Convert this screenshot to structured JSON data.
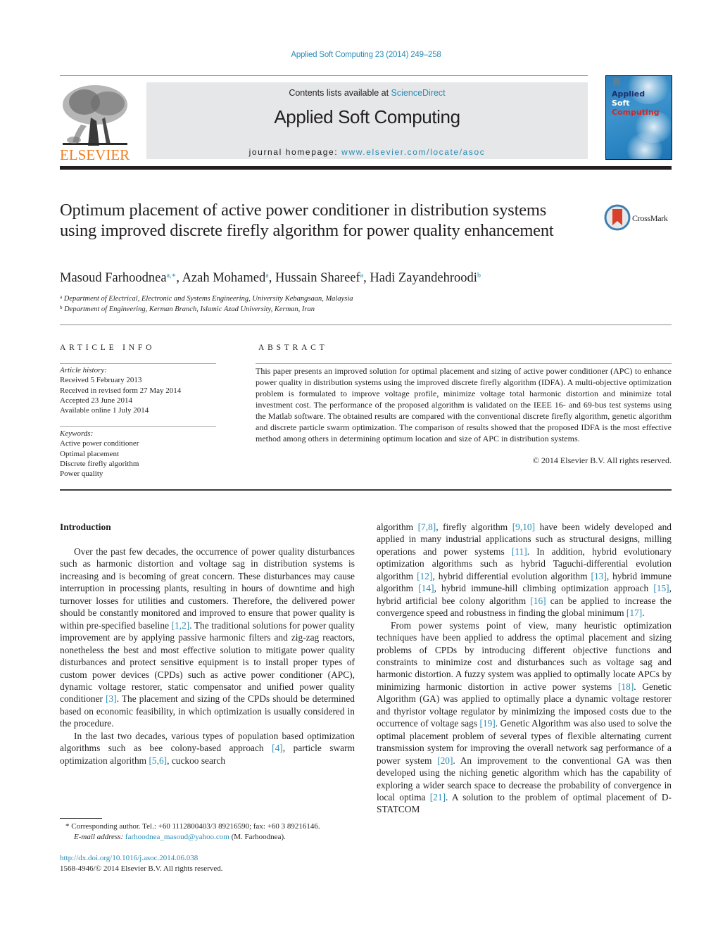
{
  "header": {
    "journal_ref": "Applied Soft Computing 23 (2014) 249–258",
    "contents_prefix": "Contents lists available at ",
    "contents_link": "ScienceDirect",
    "journal_title": "Applied Soft Computing",
    "homepage_prefix": "journal homepage: ",
    "homepage_link": "www.elsevier.com/locate/asoc",
    "publisher_logo_text": "ELSEVIER",
    "cover": {
      "line1": "Applied",
      "line2": "Soft",
      "line3": "Computing"
    },
    "colors": {
      "link": "#2a8cb5",
      "elsevier_orange": "#f07f24",
      "cover_blue": "#2b7fbd",
      "cover_red": "#d7261e",
      "masthead_gray": "#e6e7e8"
    }
  },
  "article": {
    "title": "Optimum placement of active power conditioner in distribution systems using improved discrete firefly algorithm for power quality enhancement",
    "crossmark_label": "CrossMark",
    "authors": [
      {
        "name": "Masoud Farhoodnea",
        "sup": "a,∗"
      },
      {
        "name": "Azah Mohamed",
        "sup": "a"
      },
      {
        "name": "Hussain Shareef",
        "sup": "a"
      },
      {
        "name": "Hadi Zayandehroodi",
        "sup": "b"
      }
    ],
    "affiliations": [
      {
        "key": "a",
        "text": "Department of Electrical, Electronic and Systems Engineering, University Kebangsaan, Malaysia"
      },
      {
        "key": "b",
        "text": "Department of Engineering, Kerman Branch, Islamic Azad University, Kerman, Iran"
      }
    ]
  },
  "article_info": {
    "heading": "ARTICLE INFO",
    "history_label": "Article history:",
    "history": [
      "Received 5 February 2013",
      "Received in revised form 27 May 2014",
      "Accepted 23 June 2014",
      "Available online 1 July 2014"
    ],
    "keywords_label": "Keywords:",
    "keywords": [
      "Active power conditioner",
      "Optimal placement",
      "Discrete firefly algorithm",
      "Power quality"
    ]
  },
  "abstract": {
    "heading": "ABSTRACT",
    "text": "This paper presents an improved solution for optimal placement and sizing of active power conditioner (APC) to enhance power quality in distribution systems using the improved discrete firefly algorithm (IDFA). A multi-objective optimization problem is formulated to improve voltage profile, minimize voltage total harmonic distortion and minimize total investment cost. The performance of the proposed algorithm is validated on the IEEE 16- and 69-bus test systems using the Matlab software. The obtained results are compared with the conventional discrete firefly algorithm, genetic algorithm and discrete particle swarm optimization. The comparison of results showed that the proposed IDFA is the most effective method among others in determining optimum location and size of APC in distribution systems.",
    "copyright": "© 2014 Elsevier B.V. All rights reserved."
  },
  "body": {
    "section_heading": "Introduction",
    "left_paragraphs": [
      [
        {
          "t": "Over the past few decades, the occurrence of power quality disturbances such as harmonic distortion and voltage sag in distribution systems is increasing and is becoming of great concern. These disturbances may cause interruption in processing plants, resulting in hours of downtime and high turnover losses for utilities and customers. Therefore, the delivered power should be constantly monitored and improved to ensure that power quality is within pre-specified baseline "
        },
        {
          "c": "[1,2]"
        },
        {
          "t": ". The traditional solutions for power quality improvement are by applying passive harmonic filters and zig-zag reactors, nonetheless the best and most effective solution to mitigate power quality disturbances and protect sensitive equipment is to install proper types of custom power devices (CPDs) such as active power conditioner (APC), dynamic voltage restorer, static compensator and unified power quality conditioner "
        },
        {
          "c": "[3]"
        },
        {
          "t": ". The placement and sizing of the CPDs should be determined based on economic feasibility, in which optimization is usually considered in the procedure."
        }
      ],
      [
        {
          "t": "In the last two decades, various types of population based optimization algorithms such as bee colony-based approach "
        },
        {
          "c": "[4]"
        },
        {
          "t": ", particle swarm optimization algorithm "
        },
        {
          "c": "[5,6]"
        },
        {
          "t": ", cuckoo search"
        }
      ]
    ],
    "right_paragraphs": [
      [
        {
          "t": "algorithm "
        },
        {
          "c": "[7,8]"
        },
        {
          "t": ", firefly algorithm "
        },
        {
          "c": "[9,10]"
        },
        {
          "t": " have been widely developed and applied in many industrial applications such as structural designs, milling operations and power systems "
        },
        {
          "c": "[11]"
        },
        {
          "t": ". In addition, hybrid evolutionary optimization algorithms such as hybrid Taguchi-differential evolution algorithm "
        },
        {
          "c": "[12]"
        },
        {
          "t": ", hybrid differential evolution algorithm "
        },
        {
          "c": "[13]"
        },
        {
          "t": ", hybrid immune algorithm "
        },
        {
          "c": "[14]"
        },
        {
          "t": ", hybrid immune-hill climbing optimization approach "
        },
        {
          "c": "[15]"
        },
        {
          "t": ", hybrid artificial bee colony algorithm "
        },
        {
          "c": "[16]"
        },
        {
          "t": " can be applied to increase the convergence speed and robustness in finding the global minimum "
        },
        {
          "c": "[17]"
        },
        {
          "t": "."
        }
      ],
      [
        {
          "t": "From power systems point of view, many heuristic optimization techniques have been applied to address the optimal placement and sizing problems of CPDs by introducing different objective functions and constraints to minimize cost and disturbances such as voltage sag and harmonic distortion. A fuzzy system was applied to optimally locate APCs by minimizing harmonic distortion in active power systems "
        },
        {
          "c": "[18]"
        },
        {
          "t": ". Genetic Algorithm (GA) was applied to optimally place a dynamic voltage restorer and thyristor voltage regulator by minimizing the imposed costs due to the occurrence of voltage sags "
        },
        {
          "c": "[19]"
        },
        {
          "t": ". Genetic Algorithm was also used to solve the optimal placement problem of several types of flexible alternating current transmission system for improving the overall network sag performance of a power system "
        },
        {
          "c": "[20]"
        },
        {
          "t": ". An improvement to the conventional GA was then developed using the niching genetic algorithm which has the capability of exploring a wider search space to decrease the probability of convergence in local optima "
        },
        {
          "c": "[21]"
        },
        {
          "t": ". A solution to the problem of optimal placement of D-STATCOM"
        }
      ]
    ]
  },
  "footnote": {
    "marker": "*",
    "corresponding": "Corresponding author. Tel.: +60 1112800403/3 89216590; fax: +60 3 89216146.",
    "email_label": "E-mail address:",
    "email": "farhoodnea_masoud@yahoo.com",
    "email_suffix": " (M. Farhoodnea).",
    "doi": "http://dx.doi.org/10.1016/j.asoc.2014.06.038",
    "issn_copyright": "1568-4946/© 2014 Elsevier B.V. All rights reserved."
  }
}
